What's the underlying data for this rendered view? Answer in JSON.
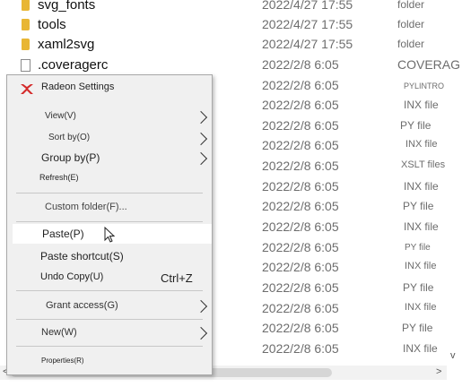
{
  "files": [
    {
      "name": "svg_fonts",
      "date": "2022/4/27 17:55",
      "type": "folder",
      "icon": "folder-icon"
    },
    {
      "name": "tools",
      "date": "2022/4/27 17:55",
      "type": "folder",
      "icon": "folder-icon"
    },
    {
      "name": "xaml2svg",
      "date": "2022/4/27 17:55",
      "type": "folder",
      "icon": "folder-icon"
    },
    {
      "name": ".coveragerc",
      "date": "2022/2/8 6:05",
      "type": "COVERAG",
      "icon": "document-icon"
    },
    {
      "name": "",
      "date": "2022/2/8 6:05",
      "type": "PYLINTRO",
      "icon": ""
    },
    {
      "name": "",
      "date": "2022/2/8 6:05",
      "type": "INX file",
      "icon": ""
    },
    {
      "name": "",
      "date": "2022/2/8 6:05",
      "type": "PY file",
      "icon": ""
    },
    {
      "name": "",
      "date": "2022/2/8 6:05",
      "type": "INX file",
      "icon": ""
    },
    {
      "name": "",
      "date": "2022/2/8 6:05",
      "type": "XSLT files",
      "icon": ""
    },
    {
      "name": "",
      "date": "2022/2/8 6:05",
      "type": "INX file",
      "icon": ""
    },
    {
      "name": "",
      "date": "2022/2/8 6:05",
      "type": "PY file",
      "icon": ""
    },
    {
      "name": "",
      "date": "2022/2/8 6:05",
      "type": "INX file",
      "icon": ""
    },
    {
      "name": "",
      "date": "2022/2/8 6:05",
      "type": "PY file",
      "icon": ""
    },
    {
      "name": "",
      "date": "2022/2/8 6:05",
      "type": "INX file",
      "icon": ""
    },
    {
      "name": "",
      "date": "2022/2/8 6:05",
      "type": "PY file",
      "icon": ""
    },
    {
      "name": "",
      "date": "2022/2/8 6:05",
      "type": "INX file",
      "icon": ""
    },
    {
      "name": "",
      "date": "2022/2/8 6:05",
      "type": "PY file",
      "icon": ""
    },
    {
      "name": "",
      "date": "2022/2/8 6:05",
      "type": "INX file",
      "icon": ""
    }
  ],
  "context_menu": {
    "radeon": "Radeon Settings",
    "view": "View(V)",
    "sort_by": "Sort by(O)",
    "group_by": "Group by(P)",
    "refresh": "Refresh(E)",
    "custom_folder": "Custom folder(F)...",
    "paste": "Paste(P)",
    "paste_shortcut": "Paste shortcut(S)",
    "undo_copy": "Undo Copy(U)",
    "undo_copy_shortcut": "Ctrl+Z",
    "grant_access": "Grant access(G)",
    "new": "New(W)",
    "properties": "Properties(R)"
  },
  "colors": {
    "folder": "#e8b634",
    "radeon": "#d42a2a",
    "menu_bg": "#f0f0f0"
  },
  "scroll": {
    "left_arrow": "<",
    "right_arrow": ">",
    "down_arrow": "v"
  }
}
